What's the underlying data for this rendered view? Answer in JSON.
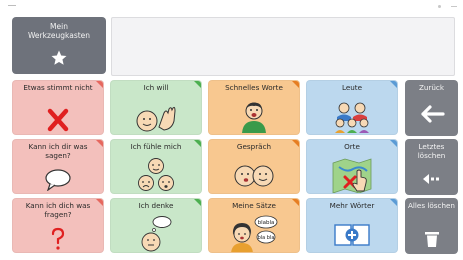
{
  "toolbox": {
    "label": "Mein\nWerkzeugkasten",
    "icon": "star-icon"
  },
  "message_bar": {
    "text": ""
  },
  "tiles": [
    {
      "label": "Etwas stimmt nicht",
      "icon": "red-x-icon",
      "color": "#f3c0bc"
    },
    {
      "label": "Ich will",
      "icon": "grabbing-hand-icon",
      "color": "#c9e7c9"
    },
    {
      "label": "Schnelles Worte",
      "icon": "person-talking-icon",
      "color": "#f8c890"
    },
    {
      "label": "Leute",
      "icon": "group-of-people-icon",
      "color": "#bcd8ee"
    },
    {
      "label": "Kann ich dir was sagen?",
      "icon": "speech-bubble-icon",
      "color": "#f3c0bc"
    },
    {
      "label": "Ich fühle mich",
      "icon": "feeling-faces-icon",
      "color": "#c9e7c9"
    },
    {
      "label": "Gespräch",
      "icon": "two-faces-icon",
      "color": "#f8c890"
    },
    {
      "label": "Orte",
      "icon": "map-pointer-icon",
      "color": "#bcd8ee"
    },
    {
      "label": "Kann ich dich was fragen?",
      "icon": "question-mark-icon",
      "color": "#f3c0bc"
    },
    {
      "label": "Ich denke",
      "icon": "thinking-face-icon",
      "color": "#c9e7c9"
    },
    {
      "label": "Meine Sätze",
      "icon": "person-blabla-icon",
      "color": "#f8c890",
      "bubble1": "blabla",
      "bubble2": "bla bla"
    },
    {
      "label": "Mehr Wörter",
      "icon": "book-plus-icon",
      "color": "#bcd8ee"
    }
  ],
  "side_buttons": [
    {
      "label": "Zurück",
      "icon": "arrow-left-icon"
    },
    {
      "label": "Letztes löschen",
      "icon": "backspace-icon"
    },
    {
      "label": "Alles löschen",
      "icon": "trash-icon"
    }
  ]
}
